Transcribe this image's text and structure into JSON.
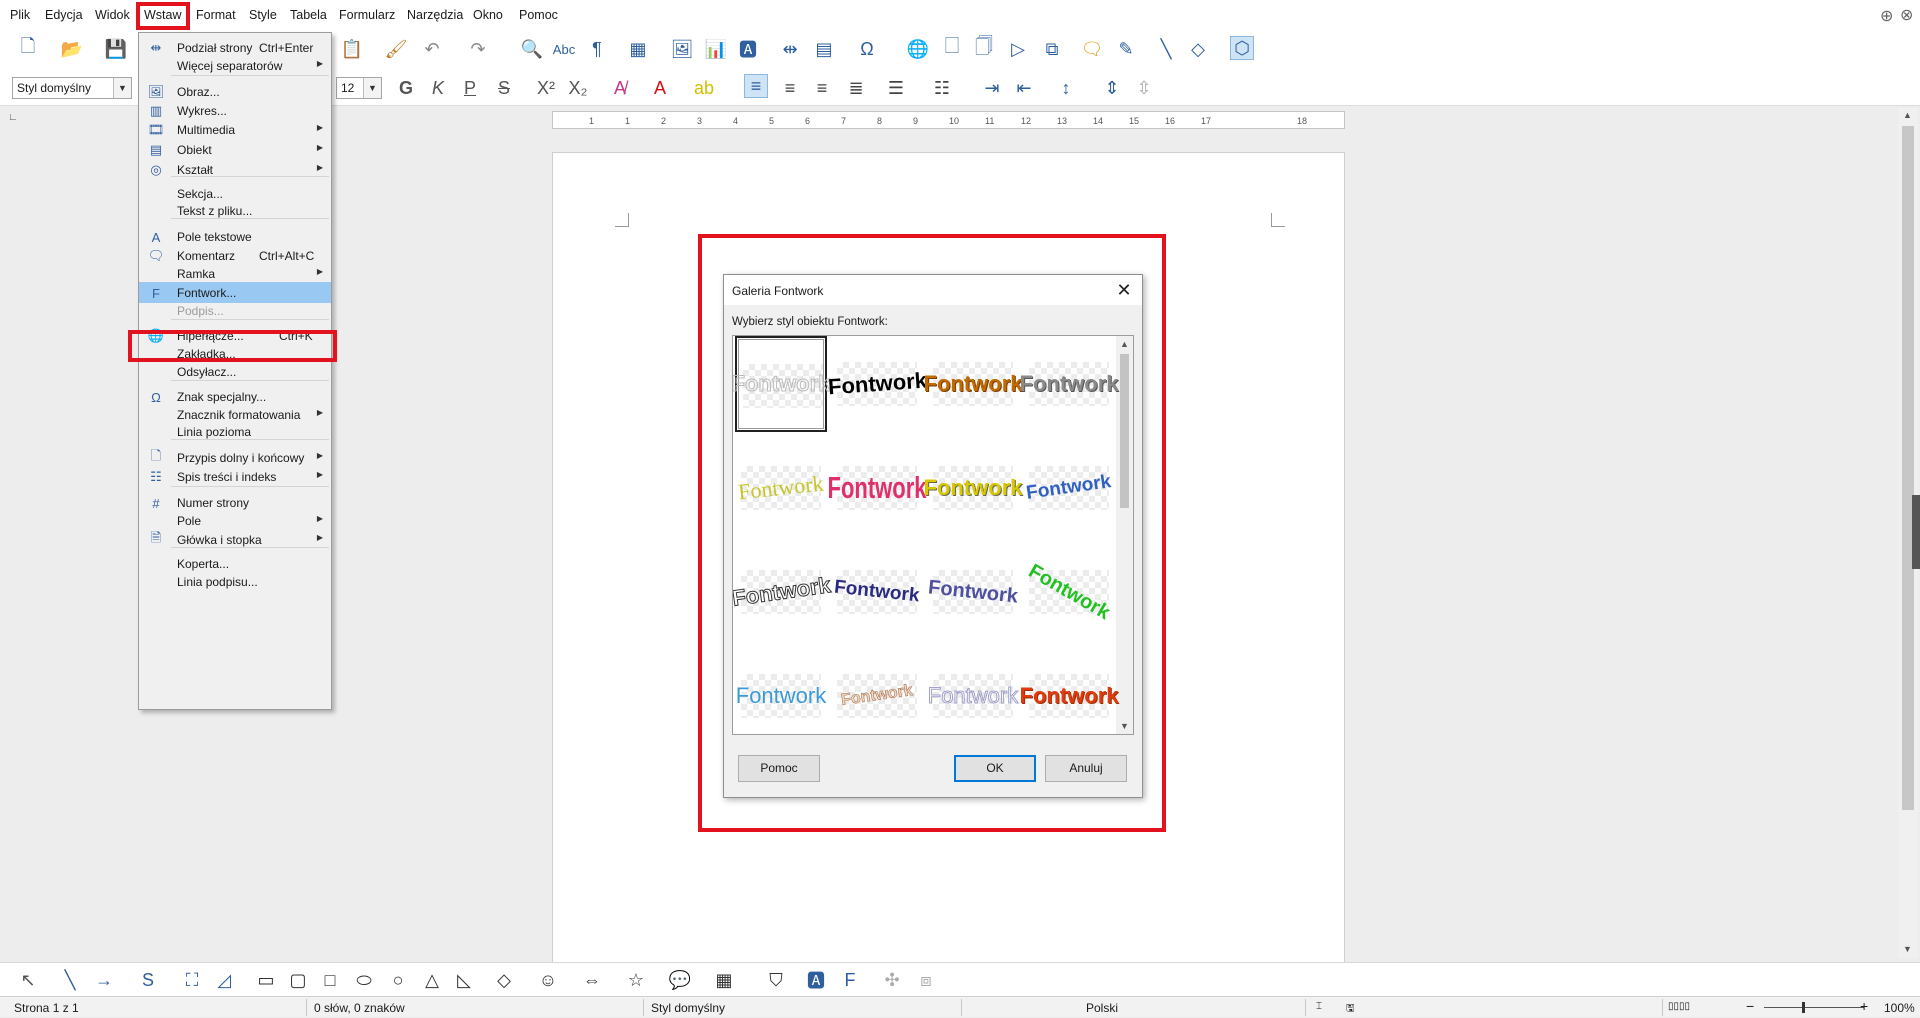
{
  "menubar": {
    "items": [
      "Plik",
      "Edycja",
      "Widok",
      "Wstaw",
      "Format",
      "Style",
      "Tabela",
      "Formularz",
      "Narzędzia",
      "Okno",
      "Pomoc"
    ]
  },
  "toolbar": {
    "paragraph_style": "Styl domyślny",
    "font_size": "12"
  },
  "ruler": {
    "ticks": [
      "1",
      "1",
      "2",
      "3",
      "4",
      "5",
      "6",
      "7",
      "8",
      "9",
      "10",
      "11",
      "12",
      "13",
      "14",
      "15",
      "16",
      "17",
      "18"
    ]
  },
  "insert_menu": {
    "items": [
      {
        "label": "Podział strony",
        "shortcut": "Ctrl+Enter",
        "icon": "page-break-icon",
        "sub": false,
        "disabled": false
      },
      {
        "label": "Więcej separatorów",
        "shortcut": "",
        "icon": "",
        "sub": true,
        "disabled": false
      },
      {
        "label": "Obraz...",
        "shortcut": "",
        "icon": "image-icon",
        "sub": false,
        "disabled": false
      },
      {
        "label": "Wykres...",
        "shortcut": "",
        "icon": "chart-icon",
        "sub": false,
        "disabled": false
      },
      {
        "label": "Multimedia",
        "shortcut": "",
        "icon": "multimedia-icon",
        "sub": true,
        "disabled": false
      },
      {
        "label": "Obiekt",
        "shortcut": "",
        "icon": "object-icon",
        "sub": true,
        "disabled": false
      },
      {
        "label": "Kształt",
        "shortcut": "",
        "icon": "shape-icon",
        "sub": true,
        "disabled": false
      },
      {
        "label": "Sekcja...",
        "shortcut": "",
        "icon": "",
        "sub": false,
        "disabled": false
      },
      {
        "label": "Tekst z pliku...",
        "shortcut": "",
        "icon": "",
        "sub": false,
        "disabled": false
      },
      {
        "label": "Pole tekstowe",
        "shortcut": "",
        "icon": "text-box-icon",
        "sub": false,
        "disabled": false
      },
      {
        "label": "Komentarz",
        "shortcut": "Ctrl+Alt+C",
        "icon": "comment-icon",
        "sub": false,
        "disabled": false
      },
      {
        "label": "Ramka",
        "shortcut": "",
        "icon": "",
        "sub": true,
        "disabled": false
      },
      {
        "label": "Fontwork...",
        "shortcut": "",
        "icon": "fontwork-icon",
        "sub": false,
        "disabled": false,
        "active": true
      },
      {
        "label": "Podpis...",
        "shortcut": "",
        "icon": "",
        "sub": false,
        "disabled": true
      },
      {
        "label": "Hiperłącze...",
        "shortcut": "Ctrl+K",
        "icon": "hyperlink-icon",
        "sub": false,
        "disabled": false
      },
      {
        "label": "Zakładka...",
        "shortcut": "",
        "icon": "",
        "sub": false,
        "disabled": false
      },
      {
        "label": "Odsyłacz...",
        "shortcut": "",
        "icon": "",
        "sub": false,
        "disabled": false
      },
      {
        "label": "Znak specjalny...",
        "shortcut": "",
        "icon": "omega-icon",
        "sub": false,
        "disabled": false
      },
      {
        "label": "Znacznik formatowania",
        "shortcut": "",
        "icon": "",
        "sub": true,
        "disabled": false
      },
      {
        "label": "Linia pozioma",
        "shortcut": "",
        "icon": "",
        "sub": false,
        "disabled": false
      },
      {
        "label": "Przypis dolny i końcowy",
        "shortcut": "",
        "icon": "footnote-icon",
        "sub": true,
        "disabled": false
      },
      {
        "label": "Spis treści i indeks",
        "shortcut": "",
        "icon": "toc-icon",
        "sub": true,
        "disabled": false
      },
      {
        "label": "Numer strony",
        "shortcut": "",
        "icon": "page-number-icon",
        "sub": false,
        "disabled": false
      },
      {
        "label": "Pole",
        "shortcut": "",
        "icon": "",
        "sub": true,
        "disabled": false
      },
      {
        "label": "Główka i stopka",
        "shortcut": "",
        "icon": "header-footer-icon",
        "sub": true,
        "disabled": false
      },
      {
        "label": "Koperta...",
        "shortcut": "",
        "icon": "",
        "sub": false,
        "disabled": false
      },
      {
        "label": "Linia podpisu...",
        "shortcut": "",
        "icon": "",
        "sub": false,
        "disabled": false
      }
    ]
  },
  "dialog": {
    "title": "Galeria Fontwork",
    "prompt": "Wybierz styl obiektu Fontwork:",
    "tile_text": "Fontwork",
    "help_label": "Pomoc",
    "ok_label": "OK",
    "cancel_label": "Anuluj",
    "tile_colors": [
      "#d9d9d9",
      "#000000",
      "#c06a00",
      "#8a8a8a",
      "#c6c62a",
      "#e0306a",
      "#d8c800",
      "#3060c0",
      "#333333",
      "#2a2a80",
      "#5050a0",
      "#22c022",
      "#3a9ad8",
      "#c08060",
      "#a0a0c8",
      "#e03a10"
    ]
  },
  "status": {
    "page": "Strona 1 z 1",
    "words": "0 słów, 0 znaków",
    "style": "Styl domyślny",
    "language": "Polski",
    "zoom": "100%"
  },
  "colors": {
    "highlight": "#e3121f",
    "menu_active": "#99c9f3"
  }
}
